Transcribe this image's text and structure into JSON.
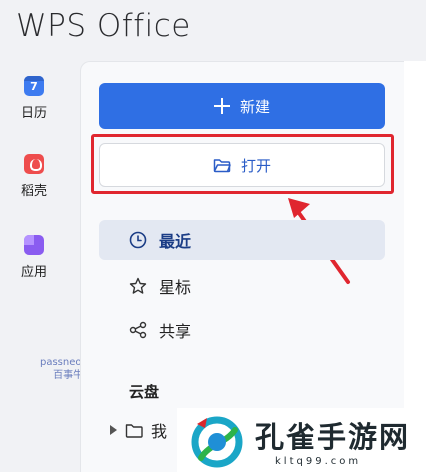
{
  "app": {
    "title": "WPS Office"
  },
  "rail": {
    "items": [
      {
        "label": "日历",
        "icon": "calendar-icon",
        "glyph": "7"
      },
      {
        "label": "稻壳",
        "icon": "docer-icon"
      },
      {
        "label": "应用",
        "icon": "apps-icon"
      }
    ]
  },
  "watermark": {
    "line1": "passneo.cn",
    "line2": "百事牛"
  },
  "actions": {
    "new_label": "新建",
    "open_label": "打开"
  },
  "nav": {
    "items": [
      {
        "label": "最近",
        "icon": "clock-icon",
        "active": true
      },
      {
        "label": "星标",
        "icon": "star-icon",
        "active": false
      },
      {
        "label": "共享",
        "icon": "share-icon",
        "active": false
      }
    ]
  },
  "cloud": {
    "section_label": "云盘",
    "first_item": "我"
  },
  "logo": {
    "text": "孔雀手游网",
    "sub": "kltq99.com"
  },
  "colors": {
    "accent": "#2f6fe4",
    "highlight": "#e0262f",
    "active_bg": "#e3e8f2"
  }
}
